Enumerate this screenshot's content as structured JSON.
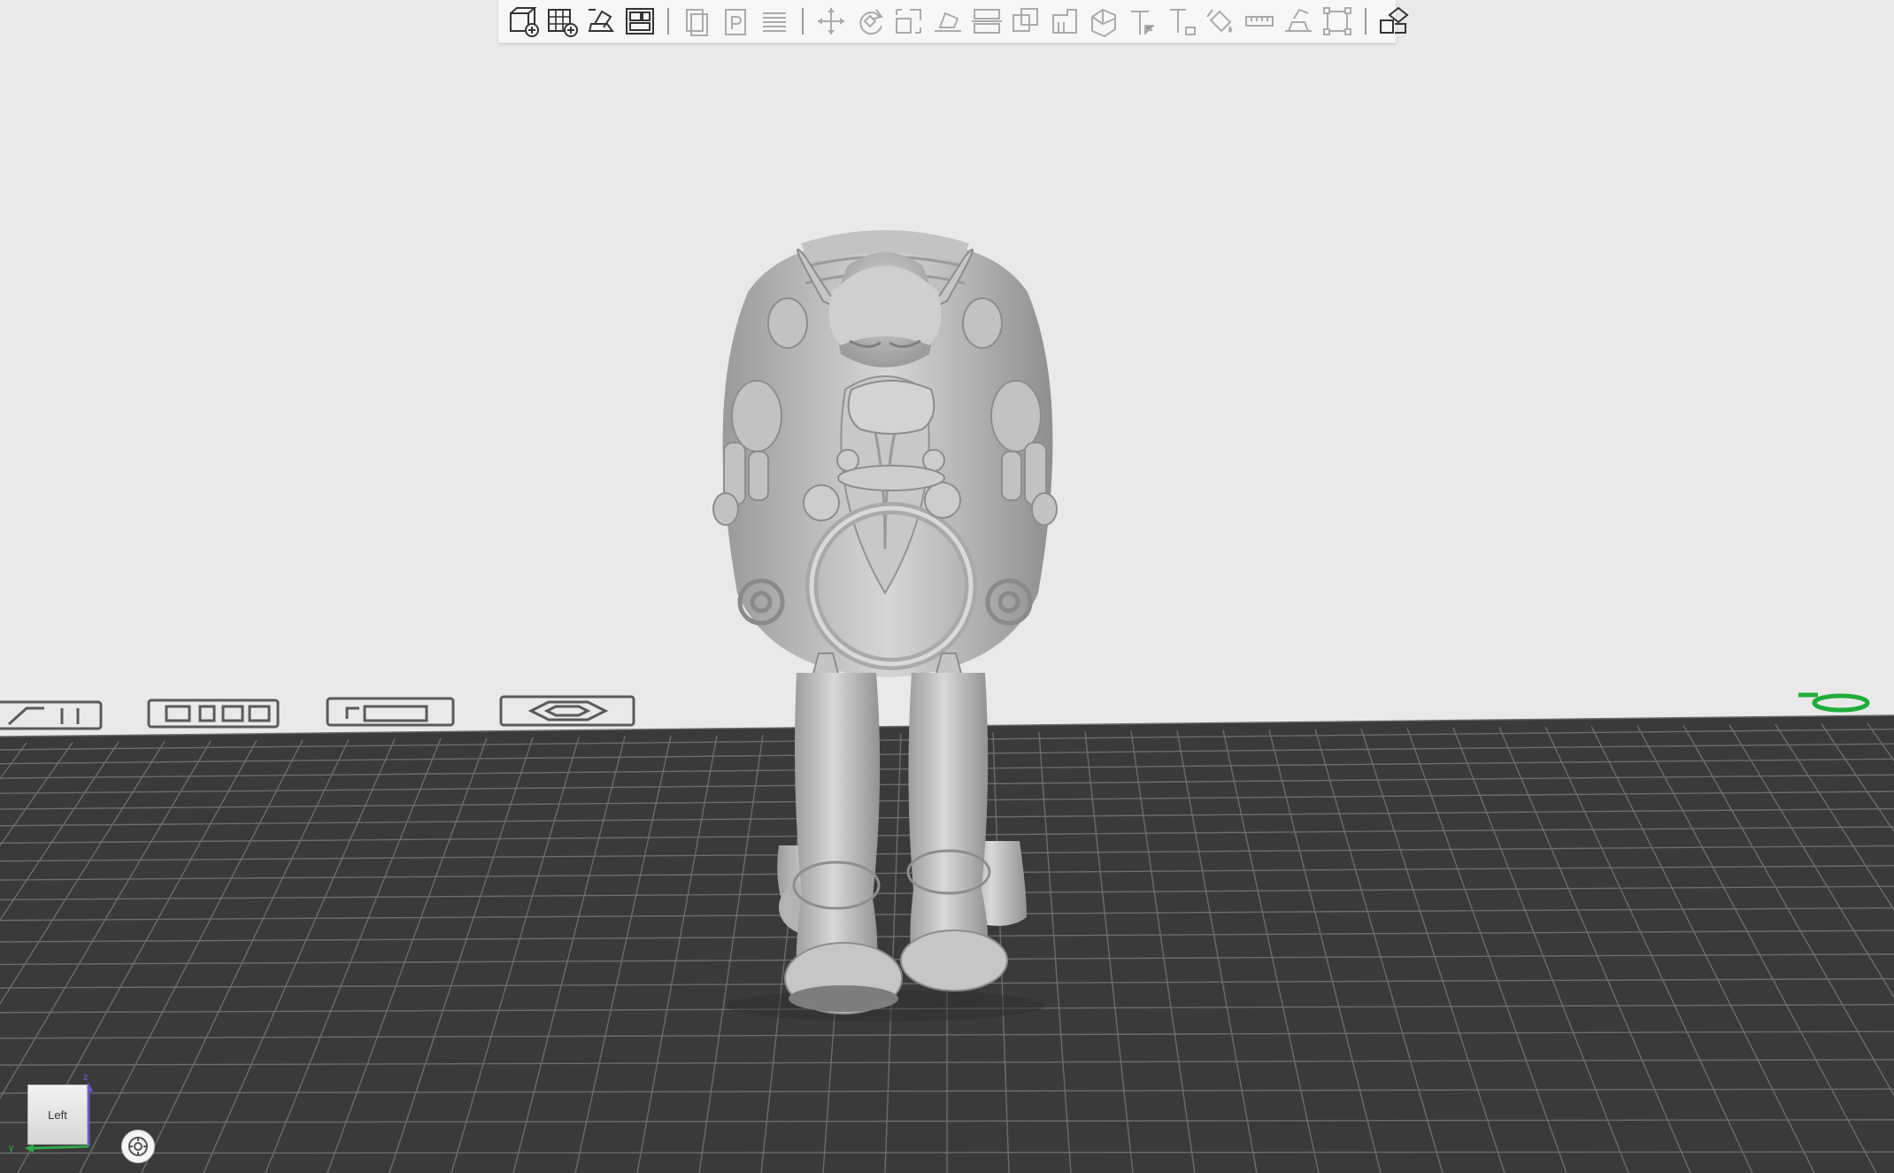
{
  "toolbar": {
    "groups": [
      [
        "add-object",
        "add-plate",
        "auto-orient",
        "arrange"
      ],
      [
        "copy",
        "paste",
        "layers"
      ],
      [
        "move",
        "rotate",
        "scale",
        "lay-on-face",
        "cut",
        "boolean",
        "support-paint",
        "seam-paint",
        "variable-layer",
        "text",
        "color-paint",
        "measure",
        "assembly",
        "fit-to-plate"
      ],
      [
        "split"
      ]
    ],
    "disabled": [
      "copy",
      "paste",
      "layers",
      "move",
      "rotate",
      "scale",
      "lay-on-face",
      "cut",
      "boolean",
      "support-paint",
      "seam-paint",
      "variable-layer",
      "text",
      "color-paint",
      "measure",
      "assembly",
      "fit-to-plate"
    ]
  },
  "view_cube": {
    "face_label": "Left",
    "axis_z": "z",
    "axis_y": "y"
  },
  "colors": {
    "background": "#e9e9e9",
    "plate": "#3a3a3a",
    "grid_line": "#6c6c6c",
    "model": "#c9c9c9",
    "accent_green": "#1fae3a"
  },
  "icons": {
    "camera": "camera-reset-icon",
    "plate_marker": "plate-origin-icon"
  }
}
